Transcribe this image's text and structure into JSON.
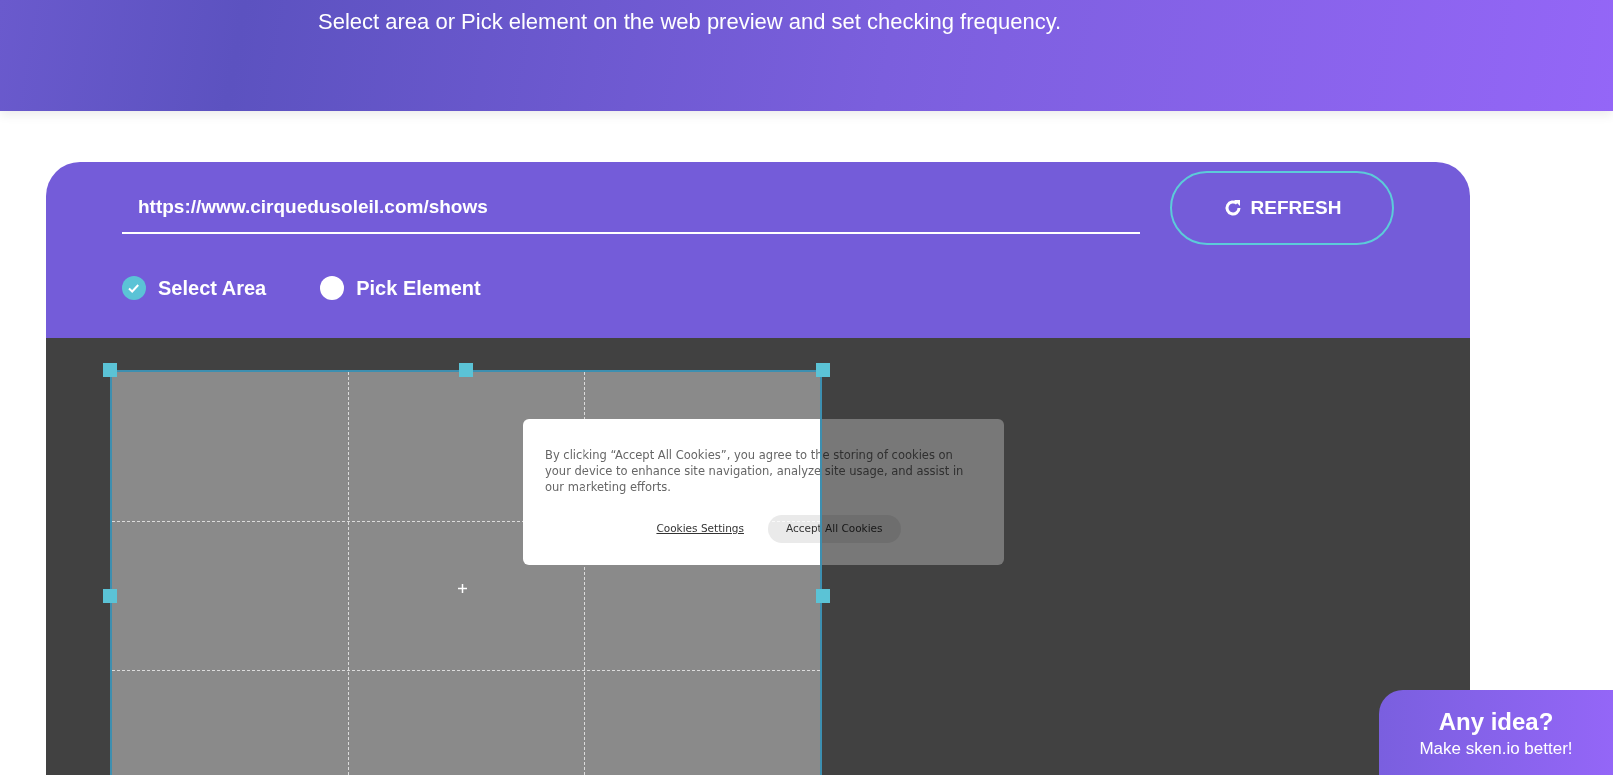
{
  "header": {
    "subtitle": "Select area or Pick element on the web preview and set checking frequency."
  },
  "url_field": {
    "value": "https://www.cirquedusoleil.com/shows"
  },
  "refresh_button": {
    "label": "REFRESH"
  },
  "modes": [
    {
      "label": "Select Area",
      "selected": true
    },
    {
      "label": "Pick Element",
      "selected": false
    }
  ],
  "preview": {
    "cookie_banner": {
      "text": "By clicking “Accept All Cookies”, you agree to the storing of cookies on your device to enhance site navigation, analyze site usage, and assist in our marketing efforts.",
      "buttons": [
        {
          "label": "Cookies Settings",
          "kind": "link"
        },
        {
          "label": "Accept All Cookies",
          "kind": "pill"
        }
      ]
    }
  },
  "feedback_widget": {
    "title": "Any idea?",
    "subtitle": "Make sken.io better!"
  }
}
